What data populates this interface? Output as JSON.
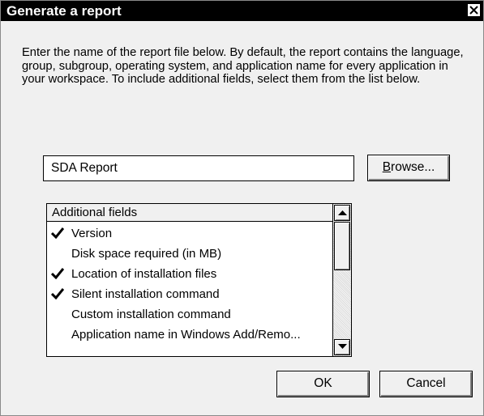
{
  "dialog": {
    "title": "Generate a report",
    "description": "Enter the name of the report file below.  By default, the report contains the language, group, subgroup, operating system, and application name for every application in your workspace.  To include additional fields, select them from the list below."
  },
  "report_file": {
    "value": "SDA Report"
  },
  "buttons": {
    "browse_mnemonic": "B",
    "browse_rest": "rowse...",
    "ok": "OK",
    "cancel": "Cancel"
  },
  "fields_list": {
    "header": "Additional fields",
    "items": [
      {
        "label": "Version",
        "checked": true
      },
      {
        "label": "Disk space required (in MB)",
        "checked": false
      },
      {
        "label": "Location of installation files",
        "checked": true
      },
      {
        "label": "Silent installation command",
        "checked": true
      },
      {
        "label": "Custom installation command",
        "checked": false
      },
      {
        "label": "Application name in Windows Add/Remo...",
        "checked": false
      }
    ]
  }
}
